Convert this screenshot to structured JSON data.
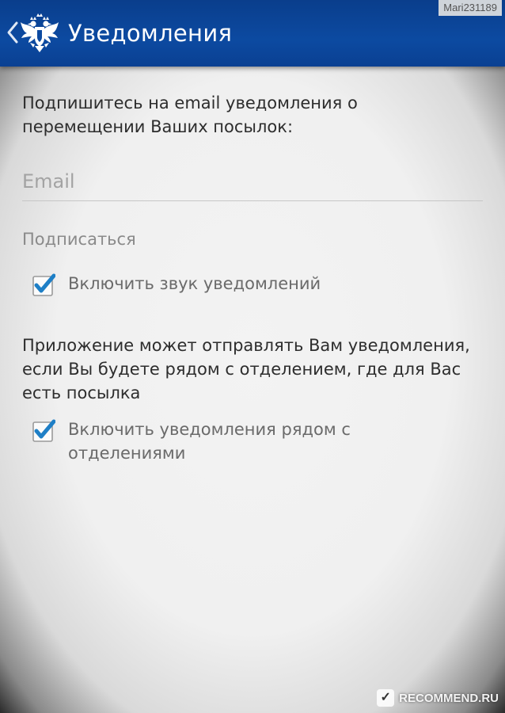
{
  "action_bar": {
    "title": "Уведомления",
    "back_icon": "chevron-left-icon",
    "logo_icon": "double-headed-eagle-logo",
    "background_color": "#0c4aa1"
  },
  "watermark_top": "Mari231189",
  "email_section": {
    "intro": "Подпишитесь на email уведомления о перемещении Ваших посылок:",
    "email_placeholder": "Email",
    "email_value": "",
    "subscribe_label": "Подписаться"
  },
  "sound_option": {
    "label": "Включить звук уведомлений",
    "checked": true
  },
  "proximity_section": {
    "text": "Приложение может отправлять Вам уведомления, если Вы будете рядом с отделением, где для Вас есть посылка"
  },
  "branches_option": {
    "label": "Включить уведомления рядом с отделениями",
    "checked": true
  },
  "watermark_bottom": {
    "icon_glyph": "✓",
    "text": "RECOMMEND.RU"
  },
  "colors": {
    "accent_check": "#1e7fc6",
    "checkbox_border": "#9a9a9a"
  }
}
